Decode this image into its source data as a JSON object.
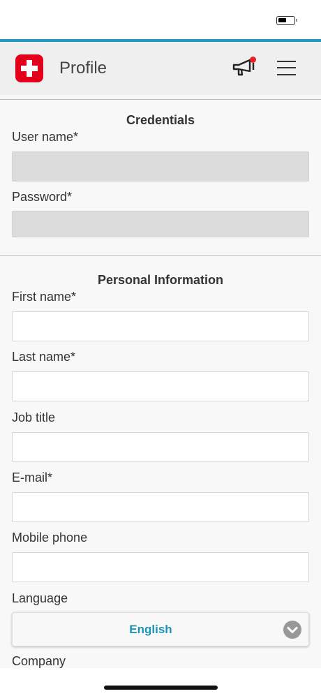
{
  "header": {
    "title": "Profile"
  },
  "colors": {
    "accent": "#1a9bbf",
    "brand_red": "#e2001a",
    "notification": "#e8202a",
    "select_text": "#1f93b5"
  },
  "icons": {
    "logo": "swiss-cross-icon",
    "announcement": "megaphone-icon",
    "menu": "hamburger-menu-icon",
    "select": "chevron-down-icon"
  },
  "credentials": {
    "title": "Credentials",
    "username_label": "User name*",
    "username_value": "",
    "password_label": "Password*",
    "password_value": ""
  },
  "personal": {
    "title": "Personal Information",
    "first_name_label": "First name*",
    "first_name_value": "",
    "last_name_label": "Last name*",
    "last_name_value": "",
    "job_title_label": "Job title",
    "job_title_value": "",
    "email_label": "E-mail*",
    "email_value": "",
    "mobile_label": "Mobile phone",
    "mobile_value": "",
    "language_label": "Language",
    "language_value": "English",
    "company_label": "Company"
  }
}
